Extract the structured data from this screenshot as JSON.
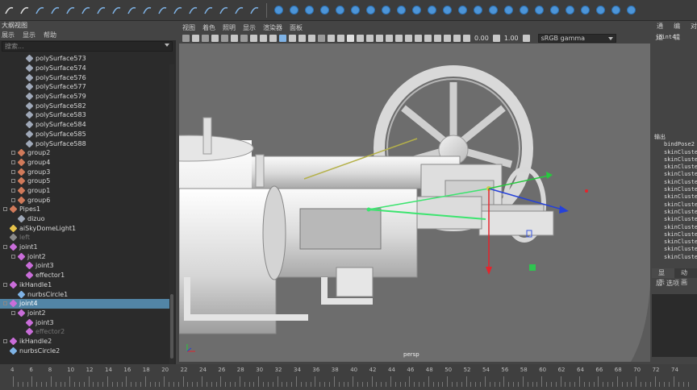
{
  "outliner": {
    "title": "大纲视图",
    "menu": [
      "展示",
      "显示",
      "帮助"
    ],
    "search_placeholder": "搜索...",
    "items": [
      {
        "label": "polySurface573",
        "type": "mesh"
      },
      {
        "label": "polySurface574",
        "type": "mesh"
      },
      {
        "label": "polySurface576",
        "type": "mesh"
      },
      {
        "label": "polySurface577",
        "type": "mesh"
      },
      {
        "label": "polySurface579",
        "type": "mesh"
      },
      {
        "label": "polySurface582",
        "type": "mesh"
      },
      {
        "label": "polySurface583",
        "type": "mesh"
      },
      {
        "label": "polySurface584",
        "type": "mesh"
      },
      {
        "label": "polySurface585",
        "type": "mesh"
      },
      {
        "label": "polySurface588",
        "type": "mesh"
      },
      {
        "label": "group2",
        "type": "group"
      },
      {
        "label": "group4",
        "type": "group"
      },
      {
        "label": "group3",
        "type": "group"
      },
      {
        "label": "group5",
        "type": "group"
      },
      {
        "label": "group1",
        "type": "group"
      },
      {
        "label": "group6",
        "type": "group"
      },
      {
        "label": "Pipes1",
        "type": "group"
      },
      {
        "label": "dizuo",
        "type": "mesh"
      },
      {
        "label": "aiSkyDomeLight1",
        "type": "light"
      },
      {
        "label": "left",
        "type": "camera"
      },
      {
        "label": "joint1",
        "type": "joint"
      },
      {
        "label": "joint2",
        "type": "joint"
      },
      {
        "label": "joint3",
        "type": "joint"
      },
      {
        "label": "effector1",
        "type": "effector"
      },
      {
        "label": "ikHandle1",
        "type": "ik"
      },
      {
        "label": "nurbsCircle1",
        "type": "curve"
      },
      {
        "label": "joint4",
        "type": "joint"
      },
      {
        "label": "joint2",
        "type": "joint"
      },
      {
        "label": "joint3",
        "type": "joint"
      },
      {
        "label": "effector2",
        "type": "effector"
      },
      {
        "label": "ikHandle2",
        "type": "ik"
      },
      {
        "label": "nurbsCircle2",
        "type": "curve"
      }
    ]
  },
  "viewport": {
    "menu": [
      "视图",
      "着色",
      "照明",
      "显示",
      "渲染器",
      "面板"
    ],
    "value1": "0.00",
    "value2": "1.00",
    "color_space": "sRGB gamma",
    "camera_label": "persp"
  },
  "channel_box": {
    "menu": [
      "通道",
      "编辑",
      "对"
    ],
    "object": "joint4",
    "outputs_header": "输出",
    "outputs": [
      "bindPose2",
      "skinCluste",
      "skinCluste",
      "skinCluste",
      "skinCluste",
      "skinCluste",
      "skinCluste",
      "skinCluste",
      "skinCluste",
      "skinCluste",
      "skinCluste",
      "skinCluste",
      "skinCluste",
      "skinCluste",
      "skinCluste",
      "skinCluste"
    ],
    "layer_tabs": [
      "显示",
      "动画"
    ],
    "layer_menu": [
      "层",
      "选项"
    ]
  },
  "timeline": {
    "ticks": [
      "4",
      "6",
      "8",
      "10",
      "12",
      "14",
      "16",
      "18",
      "20",
      "22",
      "24",
      "26",
      "28",
      "30",
      "32",
      "34",
      "36",
      "38",
      "40",
      "42",
      "44",
      "46",
      "48",
      "50",
      "52",
      "54",
      "56",
      "58",
      "60",
      "62",
      "64",
      "66",
      "68",
      "70",
      "72",
      "74"
    ]
  },
  "colors": {
    "selection": "#5285a6",
    "viewport_bg": "#6d6d6d",
    "panel_bg": "#444444"
  }
}
